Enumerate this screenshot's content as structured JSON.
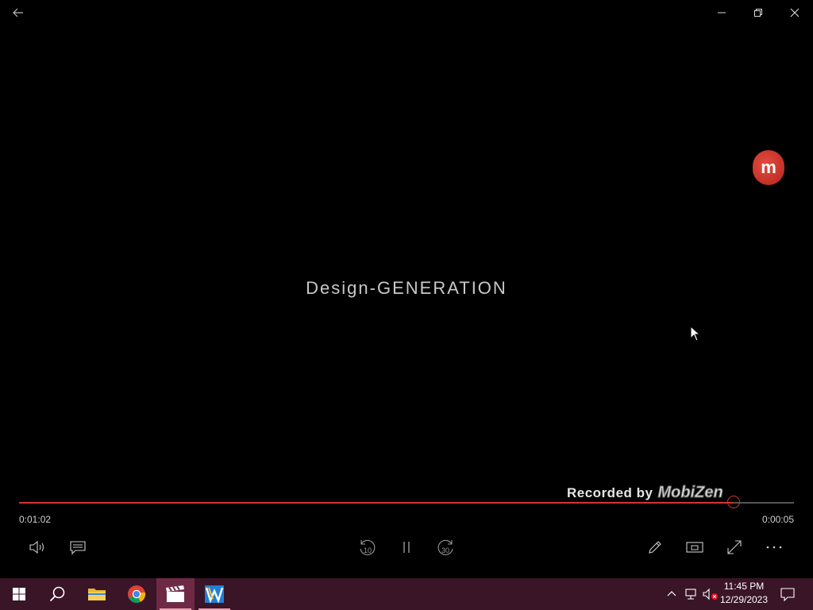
{
  "video": {
    "center_text": "Design-GENERATION",
    "badge_letter": "m",
    "watermark_prefix": "Recorded by",
    "watermark_brand": "MobiZen"
  },
  "player": {
    "elapsed": "0:01:02",
    "remaining": "0:00:05",
    "progress_fraction": 0.922,
    "skip_back_seconds": "10",
    "skip_forward_seconds": "30",
    "accent_color": "#d13438"
  },
  "taskbar": {
    "background": "#3a1427",
    "items": [
      "start-icon",
      "search-icon",
      "file-explorer-icon",
      "chrome-icon",
      "movies-tv-icon",
      "video-editor-icon"
    ],
    "clock_time": "11:45 PM",
    "clock_date": "12/29/2023"
  }
}
